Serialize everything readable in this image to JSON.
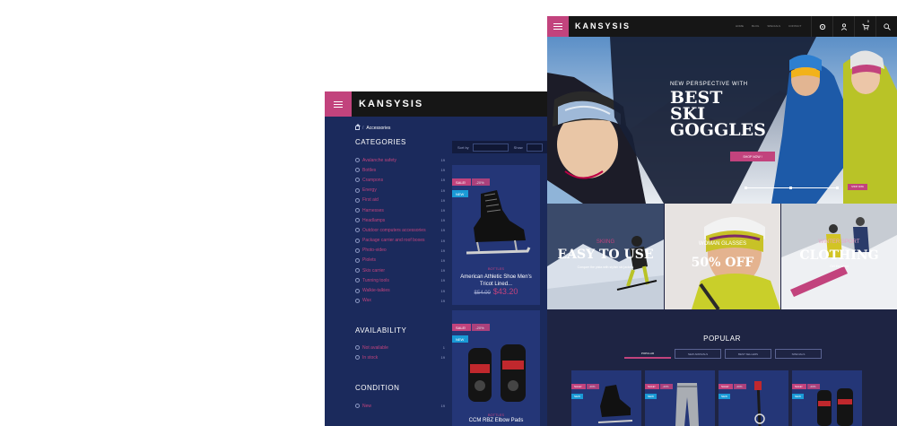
{
  "back": {
    "logo": "KANSYSIS",
    "breadcrumb": "Accessories",
    "categories_title": "CATEGORIES",
    "categories": [
      {
        "label": "Avalanche safety",
        "count": "19"
      },
      {
        "label": "Bottles",
        "count": "19"
      },
      {
        "label": "Crampons",
        "count": "19"
      },
      {
        "label": "Energy",
        "count": "19"
      },
      {
        "label": "First aid",
        "count": "19"
      },
      {
        "label": "Harnesses",
        "count": "19"
      },
      {
        "label": "Headlamps",
        "count": "19"
      },
      {
        "label": "Outdoor computers accessories",
        "count": "19"
      },
      {
        "label": "Package carrier and roof boxes",
        "count": "19"
      },
      {
        "label": "Photo-video",
        "count": "19"
      },
      {
        "label": "Piolets",
        "count": "19"
      },
      {
        "label": "Skis carrier",
        "count": "19"
      },
      {
        "label": "Tunning tools",
        "count": "19"
      },
      {
        "label": "Walkie-talkies",
        "count": "19"
      },
      {
        "label": "Wax",
        "count": "19"
      }
    ],
    "availability_title": "AVAILABILITY",
    "availability": [
      {
        "label": "Not available",
        "count": "1"
      },
      {
        "label": "In stock",
        "count": "19"
      }
    ],
    "condition_title": "CONDITION",
    "condition": [
      {
        "label": "New",
        "count": "19"
      }
    ],
    "sort_label": "Sort by",
    "show_label": "Show",
    "products": [
      {
        "sale": "SALE!",
        "discount": "-20%",
        "new": "NEW",
        "category": "BOTTLES",
        "name": "American Athletic Shoe Men's Tricot Lined...",
        "old_price": "$54.00",
        "price": "$43.20"
      },
      {
        "sale": "SALE!",
        "discount": "-20%",
        "new": "NEW",
        "category": "BOTTLES",
        "name": "CCM RBZ Elbow Pads"
      }
    ]
  },
  "front": {
    "logo": "KANSYSIS",
    "nav": [
      "HOME",
      "BLOG",
      "SPECIALS",
      "CONTACT"
    ],
    "cart_count": "0",
    "hero": {
      "subtitle": "NEW PERSPECTIVE WITH",
      "title_line1": "BEST",
      "title_line2": "SKI",
      "title_line3": "GOGGLES",
      "button": "SHOP NOW !",
      "mini_button": "SHOP NOW"
    },
    "tiles": [
      {
        "pre": "SKIING",
        "big": "EASY TO USE",
        "small": "Conquer the pista with stylish ski jackets"
      },
      {
        "pre": "WOMAN GLASSES",
        "big": "50% OFF",
        "small": ""
      },
      {
        "pre": "WINTER SPORT",
        "big": "CLOTHING",
        "small": "Get the latest"
      }
    ],
    "popular_title": "POPULAR",
    "tabs": [
      "POPULAR",
      "NEW ARRIVALS",
      "BEST SELLERS",
      "SPECIALS"
    ],
    "mini_products": [
      {
        "sale": "SALE!",
        "discount": "-20%",
        "new": "NEW"
      },
      {
        "sale": "SALE!",
        "discount": "-20%",
        "new": "NEW"
      },
      {
        "sale": "SALE!",
        "discount": "-20%",
        "new": "NEW"
      },
      {
        "sale": "SALE!",
        "discount": "-20%",
        "new": "NEW"
      }
    ]
  },
  "colors": {
    "accent": "#c2437d",
    "navy": "#1b2a5c",
    "card": "#243677",
    "new_badge": "#1a9ad6"
  }
}
